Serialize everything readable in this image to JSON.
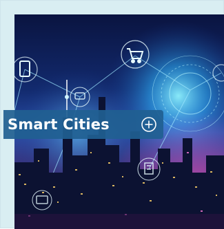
{
  "card": {
    "title": "Smart Cities",
    "action_icon": "plus-circle-icon",
    "image_icons": [
      "tablet-icon",
      "shopping-cart-icon",
      "chat-bubble-icon",
      "building-icon",
      "phone-icon"
    ]
  },
  "colors": {
    "label_background": "#215F91",
    "label_text": "#FFFFFF",
    "card_background": "#D9EEF2"
  }
}
